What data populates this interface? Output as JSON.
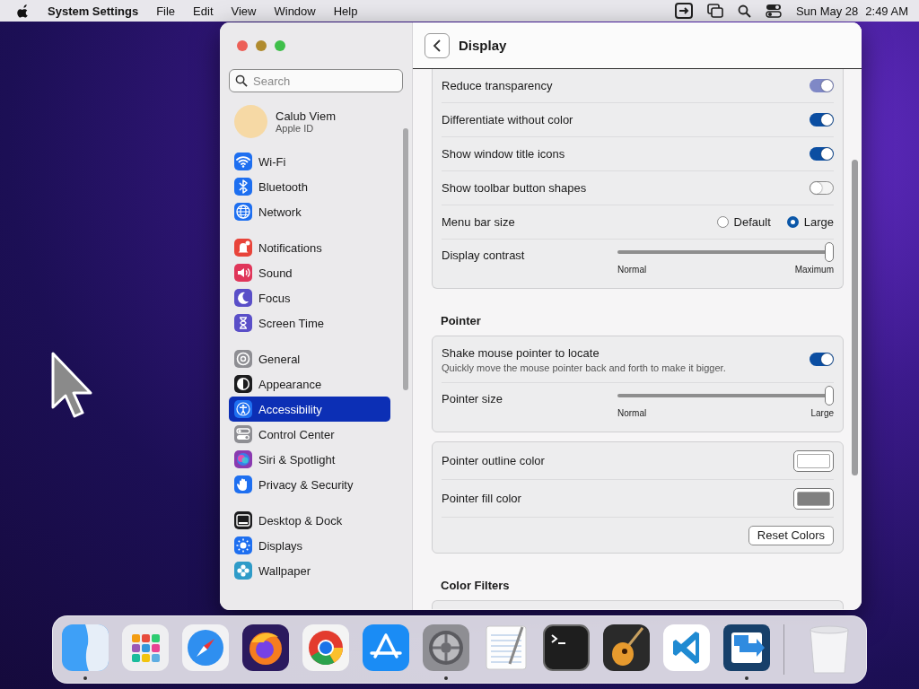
{
  "menu_bar": {
    "app": "System Settings",
    "menus": [
      "File",
      "Edit",
      "View",
      "Window",
      "Help"
    ],
    "date": "Sun May 28",
    "time": "2:49 AM"
  },
  "sidebar": {
    "search": {
      "placeholder": "Search"
    },
    "account": {
      "name": "Calub Viem",
      "subtitle": "Apple ID"
    },
    "groups": [
      [
        {
          "label": "Wi-Fi",
          "selected": false,
          "color": "#1e6ff0"
        },
        {
          "label": "Bluetooth",
          "selected": false,
          "color": "#1e6ff0"
        },
        {
          "label": "Network",
          "selected": false,
          "color": "#1e6ff0"
        }
      ],
      [
        {
          "label": "Notifications",
          "selected": false,
          "color": "#e8443a"
        },
        {
          "label": "Sound",
          "selected": false,
          "color": "#e0365a"
        },
        {
          "label": "Focus",
          "selected": false,
          "color": "#5a4fc8"
        },
        {
          "label": "Screen Time",
          "selected": false,
          "color": "#5a4fc8"
        }
      ],
      [
        {
          "label": "General",
          "selected": false,
          "color": "#8e8e93"
        },
        {
          "label": "Appearance",
          "selected": false,
          "color": "#1c1c1e"
        },
        {
          "label": "Accessibility",
          "selected": true,
          "color": "#1e6ff0"
        },
        {
          "label": "Control Center",
          "selected": false,
          "color": "#8e8e93"
        },
        {
          "label": "Siri & Spotlight",
          "selected": false,
          "color": "#8a3ab0"
        },
        {
          "label": "Privacy & Security",
          "selected": false,
          "color": "#1e6ff0"
        }
      ],
      [
        {
          "label": "Desktop & Dock",
          "selected": false,
          "color": "#1c1c1e"
        },
        {
          "label": "Displays",
          "selected": false,
          "color": "#1e6ff0"
        },
        {
          "label": "Wallpaper",
          "selected": false,
          "color": "#2f9bc8"
        }
      ]
    ]
  },
  "content": {
    "title": "Display",
    "sections": [
      {
        "cards": [
          {
            "rows": [
              {
                "kind": "toggle",
                "label": "Reduce transparency",
                "on": true,
                "disabled": true
              },
              {
                "kind": "toggle",
                "label": "Differentiate without color",
                "on": true,
                "disabled": false
              },
              {
                "kind": "toggle",
                "label": "Show window title icons",
                "on": true,
                "disabled": false
              },
              {
                "kind": "toggle",
                "label": "Show toolbar button shapes",
                "on": false,
                "disabled": false
              },
              {
                "kind": "radio",
                "label": "Menu bar size",
                "options": [
                  {
                    "label": "Default",
                    "selected": false
                  },
                  {
                    "label": "Large",
                    "selected": true
                  }
                ]
              },
              {
                "kind": "slider",
                "label": "Display contrast",
                "level": 1,
                "min_label": "Normal",
                "max_label": "Maximum"
              }
            ]
          }
        ]
      },
      {
        "heading": "Pointer",
        "cards": [
          {
            "rows": [
              {
                "kind": "toggle",
                "label": "Shake mouse pointer to locate",
                "description": "Quickly move the mouse pointer back and forth to make it bigger.",
                "on": true,
                "disabled": false
              },
              {
                "kind": "slider",
                "label": "Pointer size",
                "level": 1,
                "min_label": "Normal",
                "max_label": "Large"
              }
            ]
          },
          {
            "rows": [
              {
                "kind": "color",
                "label": "Pointer outline color",
                "color": "#ffffff"
              },
              {
                "kind": "color",
                "label": "Pointer fill color",
                "color": "#808080"
              },
              {
                "kind": "button",
                "label": "Reset Colors"
              }
            ]
          }
        ]
      },
      {
        "heading": "Color Filters"
      }
    ]
  },
  "dock": {
    "apps": [
      {
        "running": true
      },
      {
        "running": false
      },
      {
        "running": false
      },
      {
        "running": false
      },
      {
        "running": false
      },
      {
        "running": false
      },
      {
        "running": true
      },
      {
        "running": false
      },
      {
        "running": false
      },
      {
        "running": false
      },
      {
        "running": false
      },
      {
        "running": true
      }
    ]
  }
}
